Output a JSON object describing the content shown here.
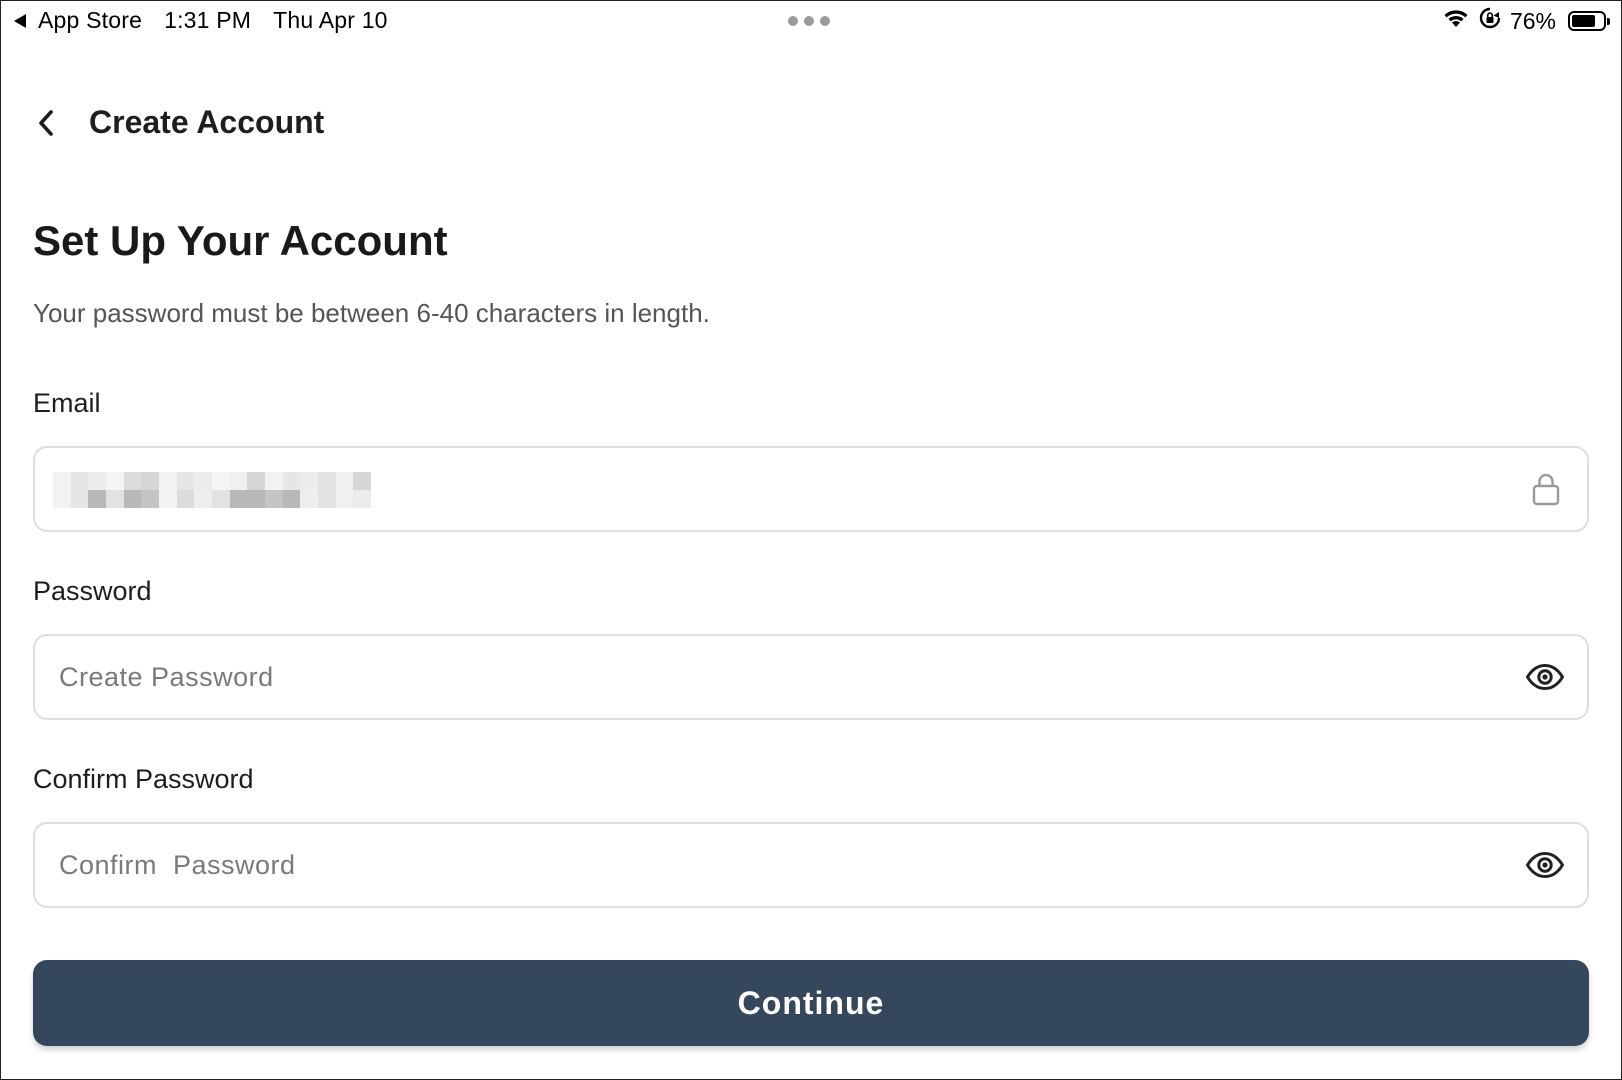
{
  "status_bar": {
    "back_app": "App Store",
    "time": "1:31 PM",
    "date": "Thu Apr 10",
    "battery_percent": "76%",
    "battery_level": 0.76,
    "icons": [
      "wifi-icon",
      "orientation-lock-icon",
      "battery-icon"
    ]
  },
  "nav": {
    "title": "Create Account",
    "back_icon": "chevron-left-icon"
  },
  "main": {
    "title": "Set Up Your Account",
    "subtitle": "Your password must be between 6-40 characters in length."
  },
  "form": {
    "email": {
      "label": "Email",
      "value": "",
      "redacted": true,
      "icon": "lock-icon"
    },
    "password": {
      "label": "Password",
      "placeholder": "Create Password",
      "icon": "eye-icon"
    },
    "confirm_password": {
      "label": "Confirm Password",
      "placeholder": "Confirm  Password",
      "icon": "eye-icon"
    }
  },
  "actions": {
    "continue_label": "Continue"
  },
  "colors": {
    "primary_button": "#35475c",
    "border": "#dedede",
    "muted_text": "#555555",
    "placeholder": "#7a7a7a"
  }
}
